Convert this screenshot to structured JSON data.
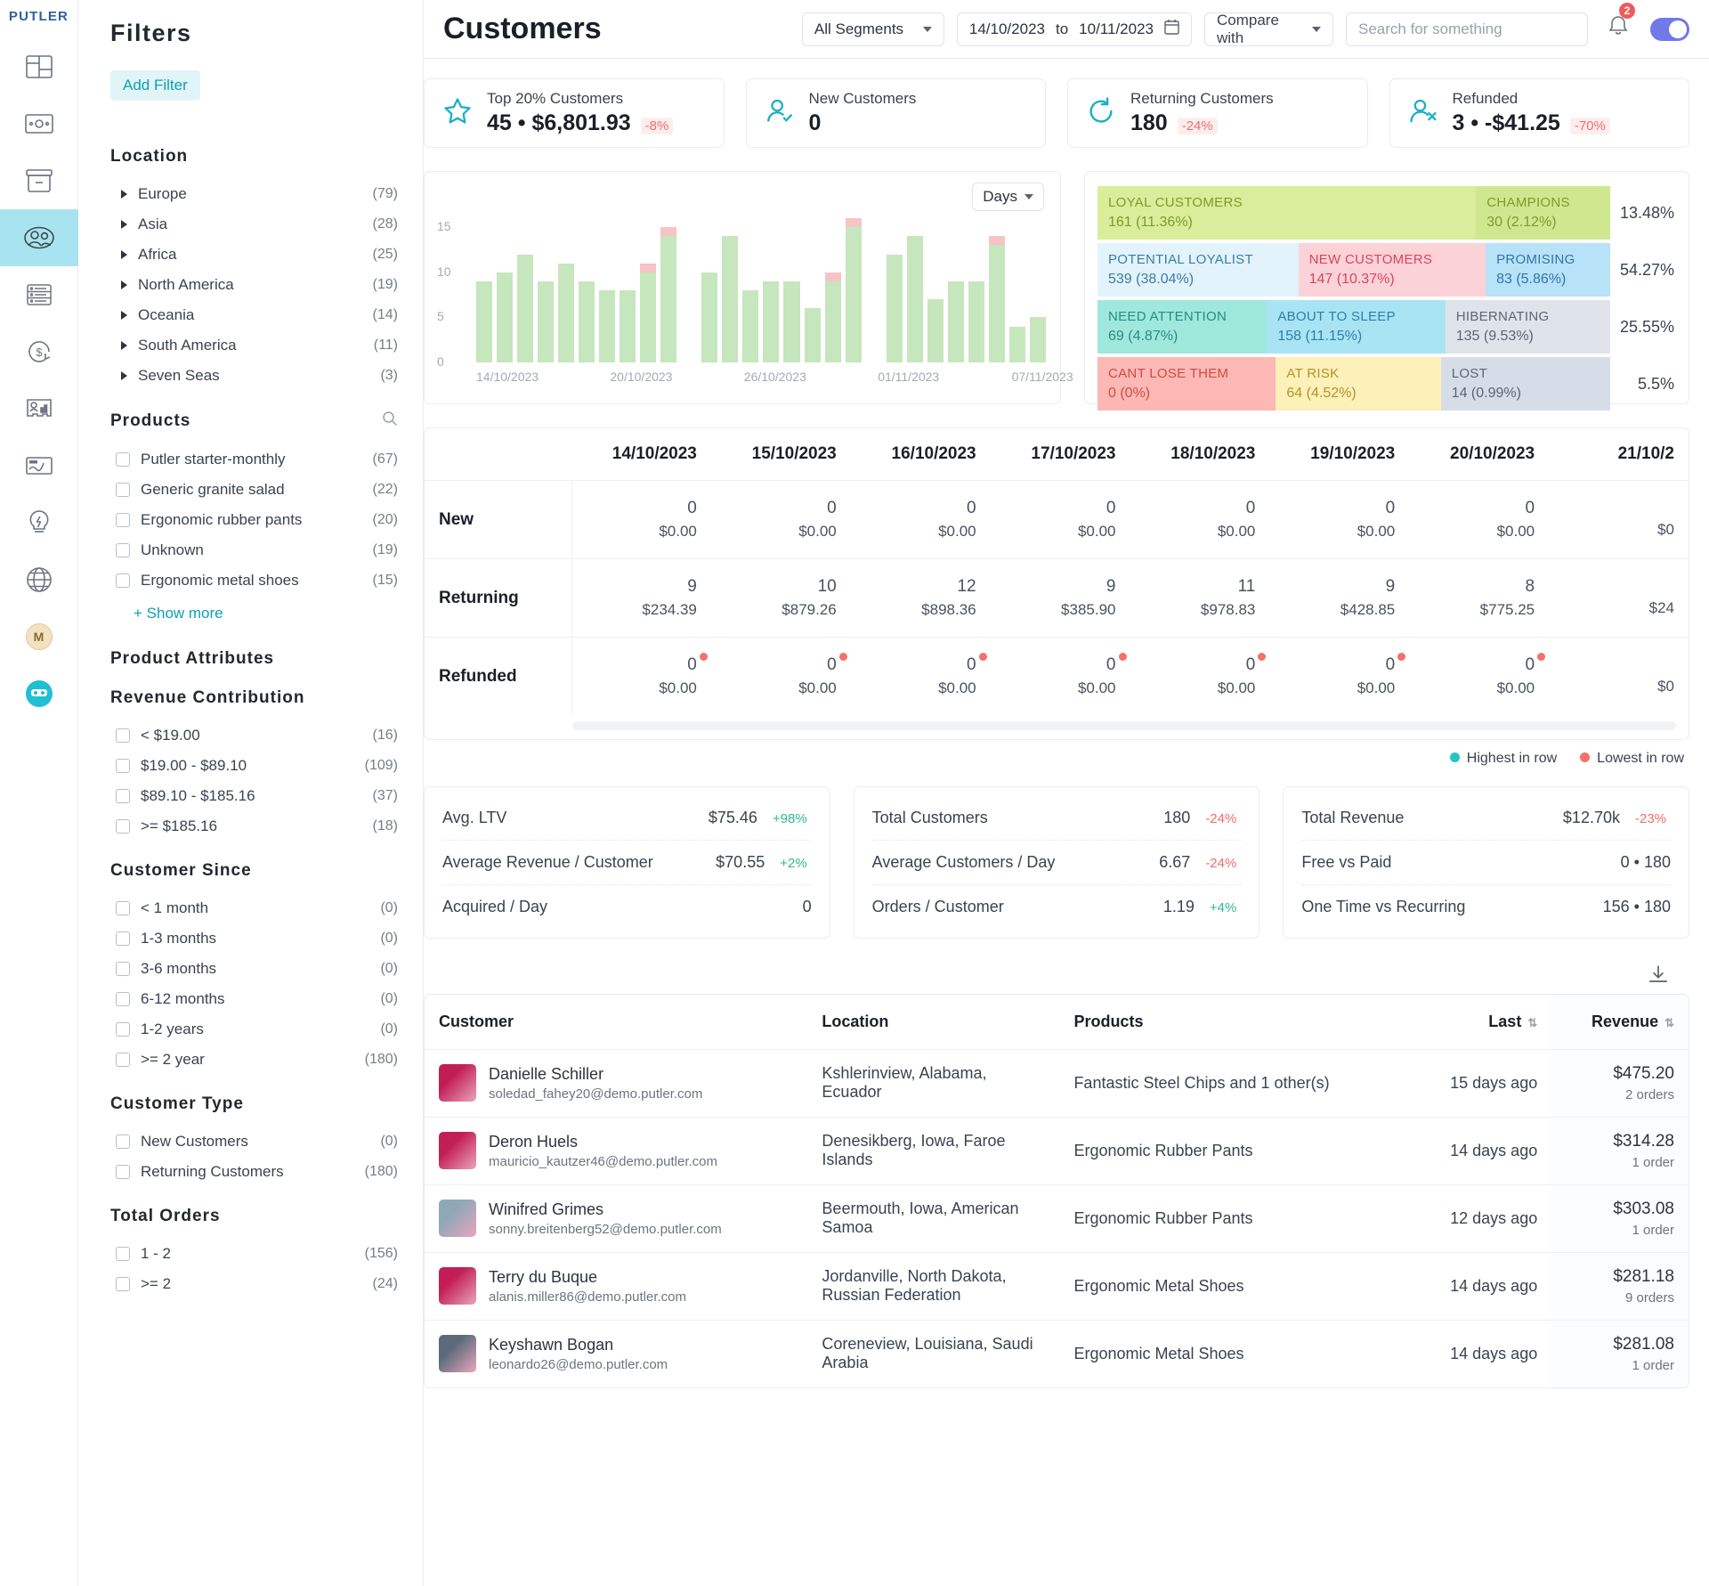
{
  "brand": "PUTLER",
  "rail": {
    "items": [
      {
        "name": "dashboard-icon",
        "label": "Dashboard"
      },
      {
        "name": "sales-icon",
        "label": "Sales"
      },
      {
        "name": "products-icon",
        "label": "Products"
      },
      {
        "name": "customers-icon",
        "label": "Customers",
        "active": true
      },
      {
        "name": "transactions-icon",
        "label": "Transactions"
      },
      {
        "name": "subscriptions-icon",
        "label": "Subscriptions"
      },
      {
        "name": "audience-icon",
        "label": "Audience"
      },
      {
        "name": "insights-icon",
        "label": "Insights"
      },
      {
        "name": "goals-icon",
        "label": "Goals"
      },
      {
        "name": "web-icon",
        "label": "Web"
      }
    ],
    "avatar_initial": "M"
  },
  "header": {
    "title": "Customers",
    "segment": "All Segments",
    "date_from": "14/10/2023",
    "date_to": "10/11/2023",
    "date_sep": "to",
    "compare": "Compare with",
    "search_placeholder": "Search for something",
    "notification_count": "2"
  },
  "filters": {
    "title": "Filters",
    "add_filter": "Add Filter",
    "location": {
      "heading": "Location",
      "items": [
        {
          "label": "Europe",
          "count": "(79)"
        },
        {
          "label": "Asia",
          "count": "(28)"
        },
        {
          "label": "Africa",
          "count": "(25)"
        },
        {
          "label": "North America",
          "count": "(19)"
        },
        {
          "label": "Oceania",
          "count": "(14)"
        },
        {
          "label": "South America",
          "count": "(11)"
        },
        {
          "label": "Seven Seas",
          "count": "(3)"
        }
      ]
    },
    "products": {
      "heading": "Products",
      "items": [
        {
          "label": "Putler starter-monthly",
          "count": "(67)"
        },
        {
          "label": "Generic granite salad",
          "count": "(22)"
        },
        {
          "label": "Ergonomic rubber pants",
          "count": "(20)"
        },
        {
          "label": "Unknown",
          "count": "(19)"
        },
        {
          "label": "Ergonomic metal shoes",
          "count": "(15)"
        }
      ],
      "show_more": "+ Show more"
    },
    "product_attributes": {
      "heading": "Product Attributes"
    },
    "revenue_contribution": {
      "heading": "Revenue Contribution",
      "items": [
        {
          "label": "< $19.00",
          "count": "(16)"
        },
        {
          "label": "$19.00 - $89.10",
          "count": "(109)"
        },
        {
          "label": "$89.10 - $185.16",
          "count": "(37)"
        },
        {
          "label": ">= $185.16",
          "count": "(18)"
        }
      ]
    },
    "customer_since": {
      "heading": "Customer Since",
      "items": [
        {
          "label": "< 1 month",
          "count": "(0)"
        },
        {
          "label": "1-3 months",
          "count": "(0)"
        },
        {
          "label": "3-6 months",
          "count": "(0)"
        },
        {
          "label": "6-12 months",
          "count": "(0)"
        },
        {
          "label": "1-2 years",
          "count": "(0)"
        },
        {
          "label": ">= 2 year",
          "count": "(180)"
        }
      ]
    },
    "customer_type": {
      "heading": "Customer Type",
      "items": [
        {
          "label": "New Customers",
          "count": "(0)"
        },
        {
          "label": "Returning Customers",
          "count": "(180)"
        }
      ]
    },
    "total_orders": {
      "heading": "Total Orders",
      "items": [
        {
          "label": "1 - 2",
          "count": "(156)"
        },
        {
          "label": ">= 2",
          "count": "(24)"
        }
      ]
    }
  },
  "kpis": [
    {
      "icon": "star-icon",
      "label": "Top 20% Customers",
      "value": "45 • $6,801.93",
      "delta": "-8%",
      "dir": "neg"
    },
    {
      "icon": "new-customer-icon",
      "label": "New Customers",
      "value": "0",
      "delta": "",
      "dir": "none"
    },
    {
      "icon": "returning-icon",
      "label": "Returning Customers",
      "value": "180",
      "delta": "-24%",
      "dir": "neg"
    },
    {
      "icon": "refunded-icon",
      "label": "Refunded",
      "value": "3 • -$41.25",
      "delta": "-70%",
      "dir": "neg"
    }
  ],
  "chart_data": {
    "type": "bar",
    "title": "",
    "granularity": "Days",
    "xlabel": "",
    "ylabel": "",
    "ylim": [
      0,
      16
    ],
    "yticks": [
      0,
      5,
      10,
      15
    ],
    "grid": false,
    "legend": "none",
    "xtick_labels": [
      "14/10/2023",
      "20/10/2023",
      "26/10/2023",
      "01/11/2023",
      "07/11/2023"
    ],
    "categories": [
      "14/10",
      "15/10",
      "16/10",
      "17/10",
      "18/10",
      "19/10",
      "20/10",
      "21/10",
      "22/10",
      "23/10",
      "24/10",
      "25/10",
      "26/10",
      "27/10",
      "28/10",
      "29/10",
      "30/10",
      "31/10",
      "01/11",
      "02/11",
      "03/11",
      "04/11",
      "05/11",
      "06/11",
      "07/11",
      "08/11",
      "09/11",
      "10/11"
    ],
    "series": [
      {
        "name": "Customers",
        "color": "#c6e6bd",
        "values": [
          9,
          10,
          12,
          9,
          11,
          9,
          8,
          8,
          10,
          14,
          0,
          10,
          14,
          8,
          9,
          9,
          6,
          9,
          15,
          0,
          12,
          14,
          7,
          9,
          9,
          13,
          4,
          5
        ]
      },
      {
        "name": "Refunded",
        "color": "#f6c3c6",
        "values": [
          0,
          0,
          0,
          0,
          0,
          0,
          0,
          0,
          1,
          1,
          0,
          0,
          0,
          0,
          0,
          0,
          0,
          1,
          1,
          0,
          0,
          0,
          0,
          0,
          0,
          1,
          0,
          0
        ]
      }
    ]
  },
  "rfm": {
    "rows": [
      {
        "pct": "13.48%",
        "cells": [
          {
            "title": "LOYAL CUSTOMERS",
            "value": "161 (11.36%)",
            "bg": "#d9ed9a",
            "fg": "#7d9b2e",
            "flex": 76
          },
          {
            "title": "CHAMPIONS",
            "value": "30 (2.12%)",
            "bg": "#cfe88f",
            "fg": "#7d9b2e",
            "flex": 24
          }
        ]
      },
      {
        "pct": "54.27%",
        "cells": [
          {
            "title": "POTENTIAL LOYALIST",
            "value": "539 (38.04%)",
            "bg": "#e2f3fb",
            "fg": "#3a7ca8",
            "flex": 40
          },
          {
            "title": "NEW CUSTOMERS",
            "value": "147 (10.37%)",
            "bg": "#fbd2d7",
            "fg": "#d9455b",
            "flex": 37
          },
          {
            "title": "PROMISING",
            "value": "83 (5.86%)",
            "bg": "#b8e2f7",
            "fg": "#2f77a8",
            "flex": 23
          }
        ]
      },
      {
        "pct": "25.55%",
        "cells": [
          {
            "title": "NEED ATTENTION",
            "value": "69 (4.87%)",
            "bg": "#9fe8dc",
            "fg": "#2a8b84",
            "flex": 33
          },
          {
            "title": "ABOUT TO SLEEP",
            "value": "158 (11.15%)",
            "bg": "#a9e4f4",
            "fg": "#2f7ea8",
            "flex": 35
          },
          {
            "title": "HIBERNATING",
            "value": "135 (9.53%)",
            "bg": "#dfe3ea",
            "fg": "#5d6675",
            "flex": 32
          }
        ]
      },
      {
        "pct": "5.5%",
        "cells": [
          {
            "title": "CANT LOSE THEM",
            "value": "0 (0%)",
            "bg": "#fcb8b4",
            "fg": "#cf4b45",
            "flex": 35
          },
          {
            "title": "AT RISK",
            "value": "64 (4.52%)",
            "bg": "#fdf0b8",
            "fg": "#b39327",
            "flex": 32
          },
          {
            "title": "LOST",
            "value": "14 (0.99%)",
            "bg": "#d6dde8",
            "fg": "#5d6675",
            "flex": 33
          }
        ]
      }
    ]
  },
  "matrix": {
    "row_label_header": "",
    "dates": [
      "14/10/2023",
      "15/10/2023",
      "16/10/2023",
      "17/10/2023",
      "18/10/2023",
      "19/10/2023",
      "20/10/2023",
      "21/10/2"
    ],
    "rows": [
      {
        "label": "New",
        "cells": [
          {
            "count": "0",
            "money": "$0.00",
            "dot": ""
          },
          {
            "count": "0",
            "money": "$0.00",
            "dot": ""
          },
          {
            "count": "0",
            "money": "$0.00",
            "dot": ""
          },
          {
            "count": "0",
            "money": "$0.00",
            "dot": ""
          },
          {
            "count": "0",
            "money": "$0.00",
            "dot": ""
          },
          {
            "count": "0",
            "money": "$0.00",
            "dot": ""
          },
          {
            "count": "0",
            "money": "$0.00",
            "dot": ""
          },
          {
            "count": "",
            "money": "$0",
            "dot": ""
          }
        ]
      },
      {
        "label": "Returning",
        "cells": [
          {
            "count": "9",
            "money": "$234.39",
            "dot": ""
          },
          {
            "count": "10",
            "money": "$879.26",
            "dot": ""
          },
          {
            "count": "12",
            "money": "$898.36",
            "dot": ""
          },
          {
            "count": "9",
            "money": "$385.90",
            "dot": ""
          },
          {
            "count": "11",
            "money": "$978.83",
            "dot": ""
          },
          {
            "count": "9",
            "money": "$428.85",
            "dot": ""
          },
          {
            "count": "8",
            "money": "$775.25",
            "dot": ""
          },
          {
            "count": "",
            "money": "$24",
            "dot": ""
          }
        ]
      },
      {
        "label": "Refunded",
        "cells": [
          {
            "count": "0",
            "money": "$0.00",
            "dot": "low"
          },
          {
            "count": "0",
            "money": "$0.00",
            "dot": "low"
          },
          {
            "count": "0",
            "money": "$0.00",
            "dot": "low"
          },
          {
            "count": "0",
            "money": "$0.00",
            "dot": "low"
          },
          {
            "count": "0",
            "money": "$0.00",
            "dot": "low"
          },
          {
            "count": "0",
            "money": "$0.00",
            "dot": "low"
          },
          {
            "count": "0",
            "money": "$0.00",
            "dot": "low"
          },
          {
            "count": "",
            "money": "$0",
            "dot": ""
          }
        ]
      }
    ],
    "legend": [
      {
        "label": "Highest in row",
        "color": "#23c5c5"
      },
      {
        "label": "Lowest in row",
        "color": "#f4706b"
      }
    ]
  },
  "stats": [
    {
      "rows": [
        {
          "label": "Avg. LTV",
          "value": "$75.46",
          "delta": "+98%",
          "dir": "pos"
        },
        {
          "label": "Average Revenue / Customer",
          "value": "$70.55",
          "delta": "+2%",
          "dir": "pos"
        },
        {
          "label": "Acquired / Day",
          "value": "0",
          "delta": "",
          "dir": "none"
        }
      ]
    },
    {
      "rows": [
        {
          "label": "Total Customers",
          "value": "180",
          "delta": "-24%",
          "dir": "neg"
        },
        {
          "label": "Average Customers / Day",
          "value": "6.67",
          "delta": "-24%",
          "dir": "neg"
        },
        {
          "label": "Orders / Customer",
          "value": "1.19",
          "delta": "+4%",
          "dir": "pos"
        }
      ]
    },
    {
      "rows": [
        {
          "label": "Total Revenue",
          "value": "$12.70k",
          "delta": "-23%",
          "dir": "neg"
        },
        {
          "label": "Free vs Paid",
          "value": "0 • 180",
          "delta": "",
          "dir": "none"
        },
        {
          "label": "One Time vs Recurring",
          "value": "156 • 180",
          "delta": "",
          "dir": "none"
        }
      ]
    }
  ],
  "customers": {
    "download_icon": "download-icon",
    "columns": [
      "Customer",
      "Location",
      "Products",
      "Last",
      "Revenue"
    ],
    "rows": [
      {
        "name": "Danielle Schiller",
        "email": "soledad_fahey20@demo.putler.com",
        "location": "Kshlerinview, Alabama, Ecuador",
        "products": "Fantastic Steel Chips and 1 other(s)",
        "last": "15 days ago",
        "revenue": "$475.20",
        "orders": "2 orders",
        "avatar": "#c21e56"
      },
      {
        "name": "Deron Huels",
        "email": "mauricio_kautzer46@demo.putler.com",
        "location": "Denesikberg, Iowa, Faroe Islands",
        "products": "Ergonomic Rubber Pants",
        "last": "14 days ago",
        "revenue": "$314.28",
        "orders": "1 order",
        "avatar": "#c21e56"
      },
      {
        "name": "Winifred Grimes",
        "email": "sonny.breitenberg52@demo.putler.com",
        "location": "Beermouth, Iowa, American Samoa",
        "products": "Ergonomic Rubber Pants",
        "last": "12 days ago",
        "revenue": "$303.08",
        "orders": "1 order",
        "avatar": "#8fa8b8"
      },
      {
        "name": "Terry du Buque",
        "email": "alanis.miller86@demo.putler.com",
        "location": "Jordanville, North Dakota, Russian Federation",
        "products": "Ergonomic Metal Shoes",
        "last": "14 days ago",
        "revenue": "$281.18",
        "orders": "9 orders",
        "avatar": "#c21e56"
      },
      {
        "name": "Keyshawn Bogan",
        "email": "leonardo26@demo.putler.com",
        "location": "Coreneview, Louisiana, Saudi Arabia",
        "products": "Ergonomic Metal Shoes",
        "last": "14 days ago",
        "revenue": "$281.08",
        "orders": "1 order",
        "avatar": "#5b6b7a"
      }
    ]
  }
}
